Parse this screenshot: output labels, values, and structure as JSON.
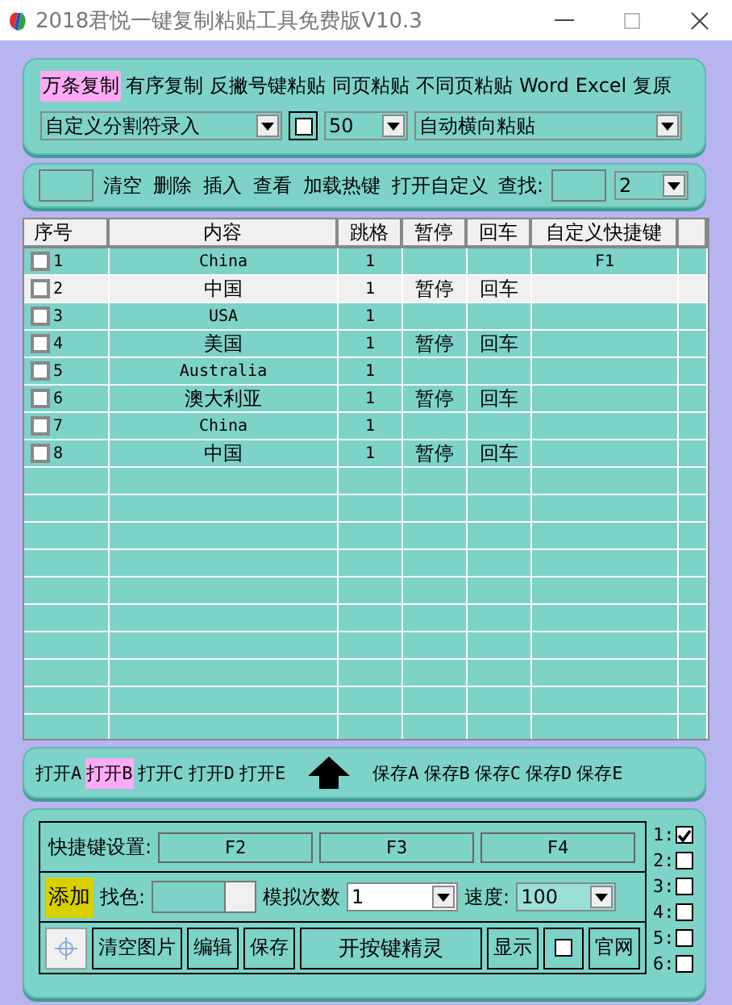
{
  "window": {
    "title": "2018君悦一键复制粘贴工具免费版V10.3"
  },
  "toolbar": {
    "modes": [
      {
        "label": "万条复制",
        "selected": true
      },
      {
        "label": "有序复制",
        "selected": false
      },
      {
        "label": "反撇号键粘贴",
        "selected": false
      },
      {
        "label": "同页粘贴",
        "selected": false
      },
      {
        "label": "不同页粘贴",
        "selected": false
      },
      {
        "label": "Word",
        "selected": false
      },
      {
        "label": "Excel",
        "selected": false
      },
      {
        "label": "复原",
        "selected": false
      }
    ],
    "separator_mode": "自定义分割符录入",
    "option_checked": false,
    "count": "50",
    "paste_mode": "自动横向粘贴"
  },
  "edit_bar": {
    "actions": [
      "清空",
      "删除",
      "插入",
      "查看",
      "加载热键",
      "打开自定义"
    ],
    "find_label": "查找:",
    "find_index": "2"
  },
  "table": {
    "columns": [
      "序号",
      "内容",
      "跳格",
      "暂停",
      "回车",
      "自定义快捷键"
    ],
    "rows": [
      {
        "checked": false,
        "selected": false,
        "cells": [
          "1",
          "China",
          "1",
          "",
          "",
          "F1"
        ]
      },
      {
        "checked": false,
        "selected": true,
        "cells": [
          "2",
          "中国",
          "1",
          "暂停",
          "回车",
          ""
        ]
      },
      {
        "checked": false,
        "selected": false,
        "cells": [
          "3",
          "USA",
          "1",
          "",
          "",
          ""
        ]
      },
      {
        "checked": false,
        "selected": false,
        "cells": [
          "4",
          "美国",
          "1",
          "暂停",
          "回车",
          ""
        ]
      },
      {
        "checked": false,
        "selected": false,
        "cells": [
          "5",
          "Australia",
          "1",
          "",
          "",
          ""
        ]
      },
      {
        "checked": false,
        "selected": false,
        "cells": [
          "6",
          "澳大利亚",
          "1",
          "暂停",
          "回车",
          ""
        ]
      },
      {
        "checked": false,
        "selected": false,
        "cells": [
          "7",
          "China",
          "1",
          "",
          "",
          ""
        ]
      },
      {
        "checked": false,
        "selected": false,
        "cells": [
          "8",
          "中国",
          "1",
          "暂停",
          "回车",
          ""
        ]
      }
    ]
  },
  "files": {
    "open": [
      {
        "label": "打开A",
        "selected": false
      },
      {
        "label": "打开B",
        "selected": true
      },
      {
        "label": "打开C",
        "selected": false
      },
      {
        "label": "打开D",
        "selected": false
      },
      {
        "label": "打开E",
        "selected": false
      }
    ],
    "save": [
      {
        "label": "保存A",
        "selected": false
      },
      {
        "label": "保存B",
        "selected": false
      },
      {
        "label": "保存C",
        "selected": false
      },
      {
        "label": "保存D",
        "selected": false
      },
      {
        "label": "保存E",
        "selected": false
      }
    ]
  },
  "hotkeys": {
    "label": "快捷键设置:",
    "keys": [
      "F2",
      "F3",
      "F4"
    ],
    "add": "添加",
    "color_label": "找色:",
    "repeat_label": "模拟次数",
    "repeat": "1",
    "speed_label": "速度:",
    "speed": "100",
    "buttons": [
      "清空图片",
      "编辑",
      "保存",
      "开按键精灵",
      "显示"
    ],
    "option_checked": false,
    "site": "官网"
  },
  "slots": [
    {
      "label": "1:",
      "checked": true
    },
    {
      "label": "2:",
      "checked": false
    },
    {
      "label": "3:",
      "checked": false
    },
    {
      "label": "4:",
      "checked": false
    },
    {
      "label": "5:",
      "checked": false
    },
    {
      "label": "6:",
      "checked": false
    }
  ]
}
